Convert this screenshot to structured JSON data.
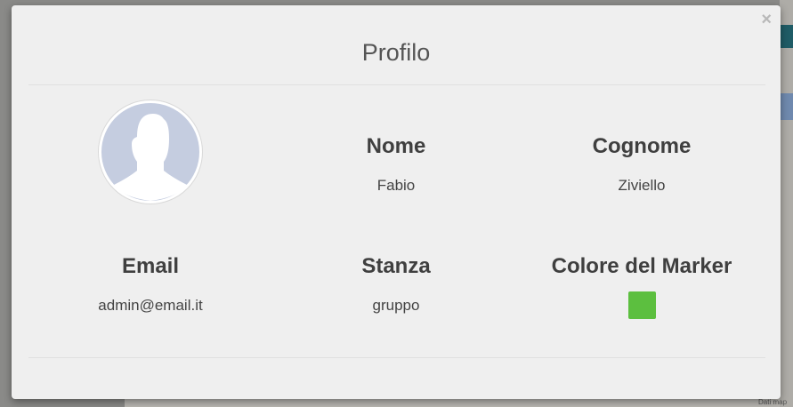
{
  "modal": {
    "title": "Profilo",
    "close_glyph": "×",
    "fields": {
      "nome": {
        "label": "Nome",
        "value": "Fabio"
      },
      "cognome": {
        "label": "Cognome",
        "value": "Ziviello"
      },
      "email": {
        "label": "Email",
        "value": "admin@email.it"
      },
      "stanza": {
        "label": "Stanza",
        "value": "gruppo"
      },
      "colore": {
        "label": "Colore del Marker",
        "color": "#5cbf3f"
      }
    },
    "avatar": {
      "icon": "default-user-silhouette-icon",
      "color": "#c5cde0"
    }
  },
  "background_map": {
    "attribution": "Dati map"
  }
}
